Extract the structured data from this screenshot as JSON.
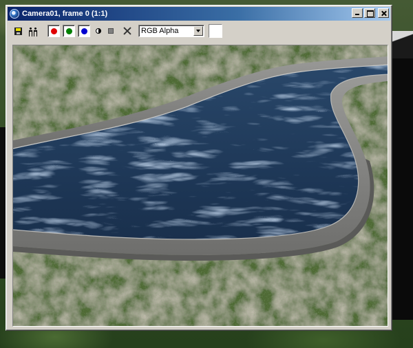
{
  "window": {
    "title": "Camera01, frame 0 (1:1)"
  },
  "toolbar": {
    "channel_select_value": "RGB Alpha",
    "icons": [
      "save-icon",
      "clone-icon",
      "red-channel-icon",
      "green-channel-icon",
      "blue-channel-icon",
      "mono-icon",
      "stop-icon",
      "clear-icon"
    ],
    "channel_colors": {
      "red": "#e00000",
      "green": "#008000",
      "blue": "#0000d0"
    },
    "swatch_color": "#ffffff"
  },
  "colors": {
    "titlebar_start": "#0a246a",
    "titlebar_end": "#a6caf0",
    "window_face": "#d4d0c8",
    "water": "#1f3a5a",
    "pool_edge": "#7c7c7c",
    "terrain": "#8a8470",
    "grass": "#4f6b36"
  }
}
